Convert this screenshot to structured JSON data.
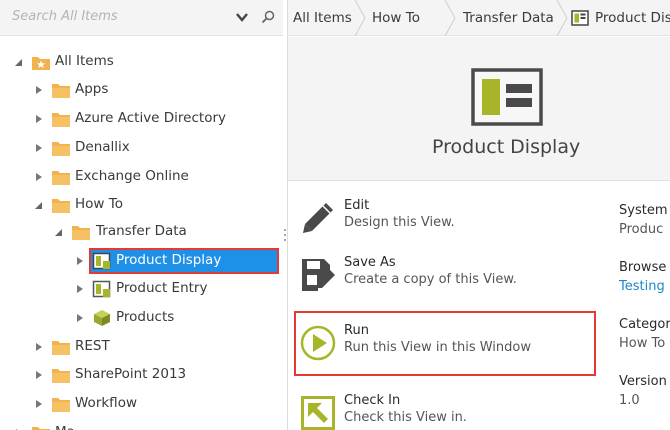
{
  "search": {
    "placeholder": "Search All Items"
  },
  "tree": {
    "root": "All Items",
    "items": [
      {
        "label": "Apps"
      },
      {
        "label": "Azure Active Directory"
      },
      {
        "label": "Denallix"
      },
      {
        "label": "Exchange Online"
      },
      {
        "label": "How To"
      },
      {
        "label": "Transfer Data"
      },
      {
        "label": "Product Display"
      },
      {
        "label": "Product Entry"
      },
      {
        "label": "Products"
      },
      {
        "label": "REST"
      },
      {
        "label": "SharePoint 2013"
      },
      {
        "label": "Workflow"
      },
      {
        "label": "Ma"
      }
    ]
  },
  "breadcrumb": [
    "All Items",
    "How To",
    "Transfer Data",
    "Product Display"
  ],
  "hero": {
    "title": "Product Display"
  },
  "actions": [
    {
      "title": "Edit",
      "desc": "Design this View."
    },
    {
      "title": "Save As",
      "desc": "Create a copy of this View."
    },
    {
      "title": "Run",
      "desc": "Run this View in this Window"
    },
    {
      "title": "Check In",
      "desc": "Check this View in."
    }
  ],
  "info": {
    "system_name_label": "System N",
    "system_name_value": "Produc",
    "browse_label": "Browse",
    "browse_value": "Testing",
    "category_label": "Categor",
    "category_value": "How To",
    "version_label": "Version",
    "version_value": "1.0"
  },
  "colors": {
    "selection": "#1e90e8",
    "highlight_border": "#e53935",
    "folder": "#f2b24d",
    "view_icon_green": "#a8b52b",
    "link": "#1e88c8"
  }
}
